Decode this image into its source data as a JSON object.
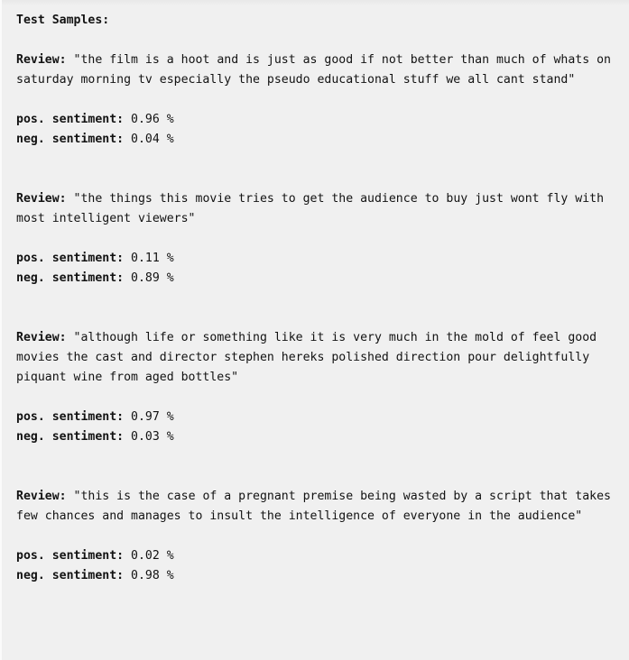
{
  "panel": {
    "heading": "Test Samples:",
    "background_color": "#f0f0f0",
    "text_color": "#121212"
  },
  "labels": {
    "review": "Review:",
    "pos_sentiment": "pos. sentiment:",
    "neg_sentiment": "neg. sentiment:"
  },
  "samples": [
    {
      "review_text": "\"the film is a hoot and is just as good if not better than much of whats on saturday morning tv especially the pseudo educational stuff we all cant stand\"",
      "pos_value": "0.96 %",
      "neg_value": "0.04 %"
    },
    {
      "review_text": "\"the things this movie tries to get the audience to buy just wont fly with most intelligent viewers\"",
      "pos_value": "0.11 %",
      "neg_value": "0.89 %"
    },
    {
      "review_text": "\"although life or something like it is very much in the mold of feel good movies the cast and director stephen hereks polished direction pour delightfully piquant wine from aged bottles\"",
      "pos_value": "0.97 %",
      "neg_value": "0.03 %"
    },
    {
      "review_text": "\"this is the case of a pregnant premise being wasted by a script that takes few chances and manages to insult the intelligence of everyone in the audience\"",
      "pos_value": "0.02 %",
      "neg_value": "0.98 %"
    }
  ]
}
